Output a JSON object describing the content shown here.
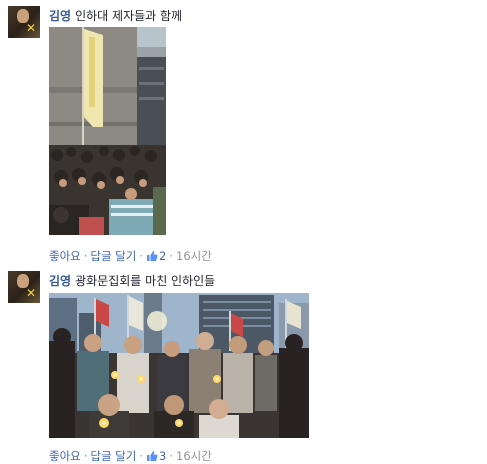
{
  "comments": [
    {
      "author": "김영",
      "message": "인하대 제자들과 함께",
      "like_label": "좋아요",
      "reply_label": "답글 달기",
      "reaction_count": "2",
      "time": "16시간",
      "photo_desc_icon": "crowd-photo-statue"
    },
    {
      "author": "김영",
      "message": "광화문집회를 마친 인하인들",
      "like_label": "좋아요",
      "reply_label": "답글 달기",
      "reaction_count": "3",
      "time": "16시간",
      "photo_desc_icon": "candlelight-group-photo"
    }
  ],
  "colors": {
    "link": "#365899",
    "action_link": "#4267b2",
    "meta": "#90949c",
    "like_icon": "#5890ff"
  },
  "icons": {
    "dot": "·",
    "thumb": "thumbs-up-icon",
    "ribbon": "yellow-ribbon-icon"
  }
}
